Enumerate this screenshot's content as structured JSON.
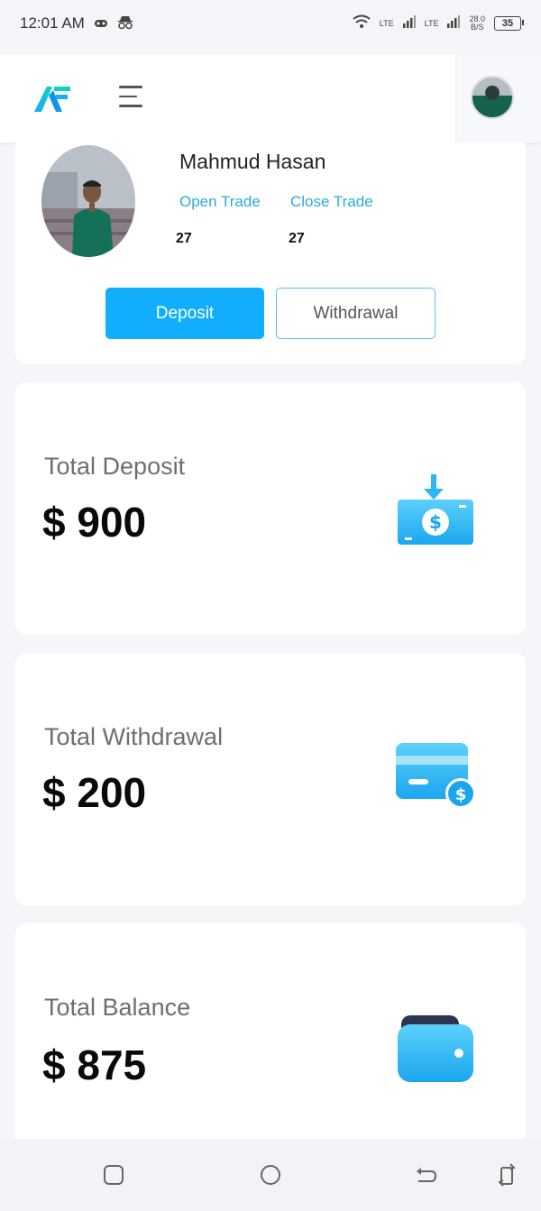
{
  "status_bar": {
    "time": "12:01 AM",
    "network_1": "LTE",
    "network_2": "LTE",
    "speed_value": "28.0",
    "speed_unit": "B/S",
    "battery": "35"
  },
  "header": {
    "logo_icon": "app-logo-icon",
    "menu_icon": "hamburger-menu-icon"
  },
  "profile": {
    "name": "Mahmud Hasan",
    "open_trade_label": "Open Trade",
    "close_trade_label": "Close Trade",
    "open_trade_count": "27",
    "close_trade_count": "27",
    "deposit_button": "Deposit",
    "withdrawal_button": "Withdrawal"
  },
  "summary": [
    {
      "label": "Total Deposit",
      "amount": "$ 900",
      "icon": "money-deposit-icon"
    },
    {
      "label": "Total Withdrawal",
      "amount": "$ 200",
      "icon": "card-withdrawal-icon"
    },
    {
      "label": "Total Balance",
      "amount": "$ 875",
      "icon": "wallet-icon"
    }
  ],
  "colors": {
    "accent": "#12aefc",
    "link": "#2fa9e0",
    "background": "#f5f6fa"
  }
}
